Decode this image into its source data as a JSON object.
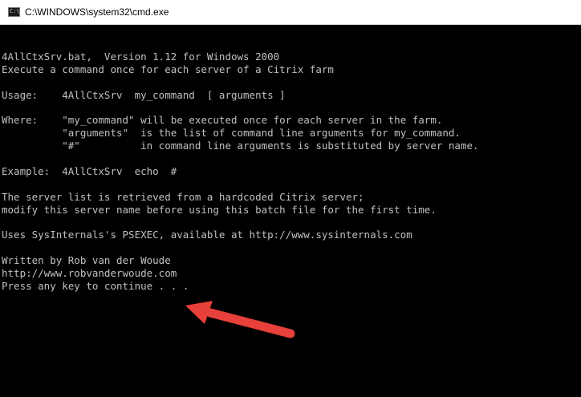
{
  "window": {
    "title": "C:\\WINDOWS\\system32\\cmd.exe",
    "icon": "cmd-prompt-icon",
    "icon_glyph": "C:\\"
  },
  "console": {
    "lines": [
      "",
      "4AllCtxSrv.bat,  Version 1.12 for Windows 2000",
      "Execute a command once for each server of a Citrix farm",
      "",
      "Usage:    4AllCtxSrv  my_command  [ arguments ]",
      "",
      "Where:    \"my_command\" will be executed once for each server in the farm.",
      "          \"arguments\"  is the list of command line arguments for my_command.",
      "          \"#\"          in command line arguments is substituted by server name.",
      "",
      "Example:  4AllCtxSrv  echo  #",
      "",
      "The server list is retrieved from a hardcoded Citrix server;",
      "modify this server name before using this batch file for the first time.",
      "",
      "Uses SysInternals's PSEXEC, available at http://www.sysinternals.com",
      "",
      "Written by Rob van der Woude",
      "http://www.robvanderwoude.com",
      "Press any key to continue . . ."
    ]
  },
  "annotation": {
    "arrow_color": "#e8403a"
  }
}
